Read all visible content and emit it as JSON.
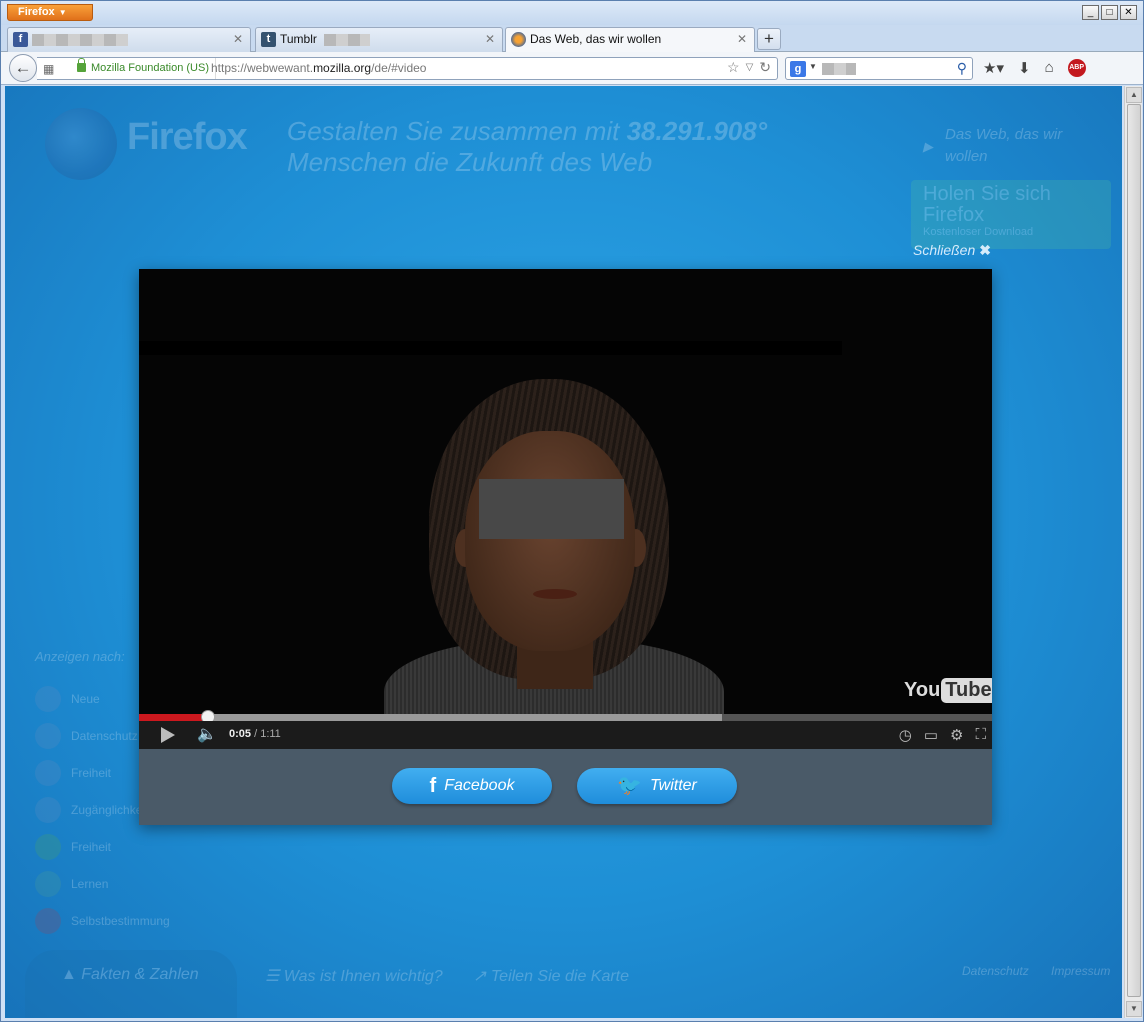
{
  "browser": {
    "menu_label": "Firefox",
    "window_buttons": [
      "_",
      "□",
      "✕"
    ],
    "tabs": [
      {
        "label": "",
        "favicon": "facebook-icon",
        "favicon_char": "f",
        "favicon_color": "#3b5998"
      },
      {
        "label": "Tumblr",
        "favicon": "tumblr-icon",
        "favicon_char": "t",
        "favicon_color": "#34526f"
      },
      {
        "label": "Das Web, das wir wollen",
        "favicon": "firefox-icon",
        "active": true
      }
    ],
    "new_tab_label": "+",
    "identity_label": "Mozilla Foundation (US)",
    "url_prefix": "https://webwewant.",
    "url_domain": "mozilla.org",
    "url_suffix": "/de/#video",
    "search_value": ""
  },
  "page": {
    "brand": "Firefox",
    "headline_part1": "Gestalten Sie zusammen mit ",
    "counter": "38.291.908",
    "counter_suffix": "°",
    "headline_part2": "Menschen die Zukunft des Web",
    "side_link": "Das Web, das wir wollen",
    "download_title": "Holen Sie sich Firefox",
    "download_sub": "Kostenloser Download",
    "close_label": "Schließen",
    "close_icon": "✖",
    "show_by_label": "Anzeigen nach:",
    "side_nav_items": [
      {
        "icon": "globe-icon",
        "label": "Neue"
      },
      {
        "icon": "eye-icon",
        "label": "Datenschutz"
      },
      {
        "icon": "heart-icon",
        "label": "Freiheit"
      },
      {
        "icon": "user-icon",
        "label": "Zugänglichkeit"
      },
      {
        "icon": "check-icon",
        "label": "Freiheit"
      },
      {
        "icon": "book-icon",
        "label": "Lernen"
      },
      {
        "icon": "gears-icon",
        "label": "Selbstbestimmung"
      }
    ],
    "bottom_nav": {
      "facts": "Fakten & Zahlen",
      "important": "Was ist Ihnen wichtig?",
      "share_map": "Teilen Sie die Karte",
      "privacy": "Datenschutz",
      "imprint": "Impressum"
    }
  },
  "video": {
    "current_time": "0:05",
    "separator": " / ",
    "total_time": "1:11",
    "played_fraction": 0.081,
    "loaded_fraction": 0.683,
    "logo_you": "You",
    "logo_tube": "Tube"
  },
  "share": {
    "facebook_label": "Facebook",
    "twitter_label": "Twitter"
  }
}
